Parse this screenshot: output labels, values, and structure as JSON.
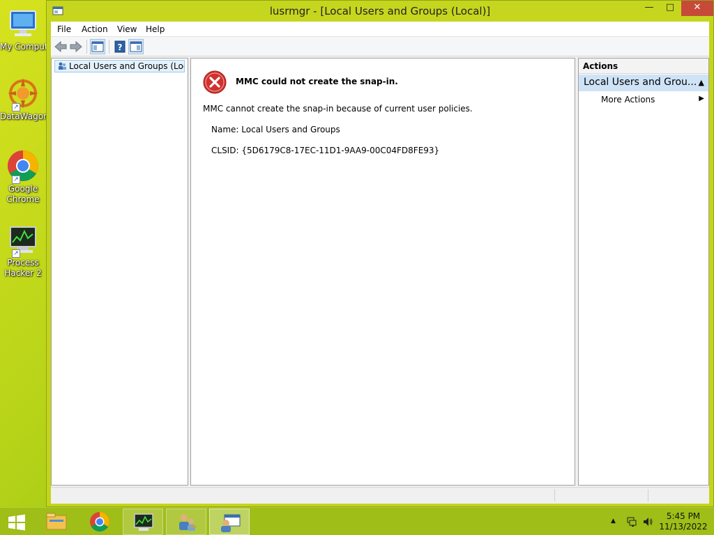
{
  "desktop": {
    "icons": [
      {
        "label_lines": [
          "My Compute"
        ],
        "icon": "computer-icon"
      },
      {
        "label_lines": [
          "DataWagon"
        ],
        "icon": "datawagon-icon"
      },
      {
        "label_lines": [
          "Google",
          "Chrome"
        ],
        "icon": "chrome-icon"
      },
      {
        "label_lines": [
          "Process",
          "Hacker 2"
        ],
        "icon": "process-hacker-icon"
      }
    ]
  },
  "window": {
    "title": "lusrmgr - [Local Users and Groups (Local)]",
    "controls": {
      "minimize": "—",
      "maximize": "□",
      "close": "✕"
    }
  },
  "menu": [
    "File",
    "Action",
    "View",
    "Help"
  ],
  "toolbar": {
    "buttons": [
      "back-icon",
      "forward-icon",
      "show-hide-console-tree-icon",
      "help-icon",
      "show-hide-action-pane-icon"
    ]
  },
  "tree": {
    "root_label": "Local Users and Groups (Local)"
  },
  "content": {
    "error_title": "MMC could not create the snap-in.",
    "error_message": "MMC cannot create the snap-in because of current user policies.",
    "name_line": "Name: Local Users and Groups",
    "clsid_line": "CLSID: {5D6179C8-17EC-11D1-9AA9-00C04FD8FE93}"
  },
  "actions": {
    "header": "Actions",
    "group_label": "Local Users and Grou...",
    "items": [
      {
        "label": "More Actions",
        "has_submenu": true
      }
    ]
  },
  "taskbar": {
    "start_icon": "windows-start-icon",
    "items": [
      {
        "icon": "file-explorer-icon",
        "state": "pinned"
      },
      {
        "icon": "chrome-icon",
        "state": "pinned"
      },
      {
        "icon": "process-hacker-icon",
        "state": "running"
      },
      {
        "icon": "users-keys-icon",
        "state": "running"
      },
      {
        "icon": "mmc-icon",
        "state": "active"
      }
    ],
    "tray": {
      "show_hidden": "▲",
      "network": "network-icon",
      "volume": "volume-icon"
    },
    "clock": {
      "time": "5:45 PM",
      "date": "11/13/2022"
    }
  },
  "colors": {
    "window_frame": "#c6d61e",
    "close_button": "#c74a39",
    "error_red": "#d0312d",
    "selection": "#cfe3f7"
  }
}
